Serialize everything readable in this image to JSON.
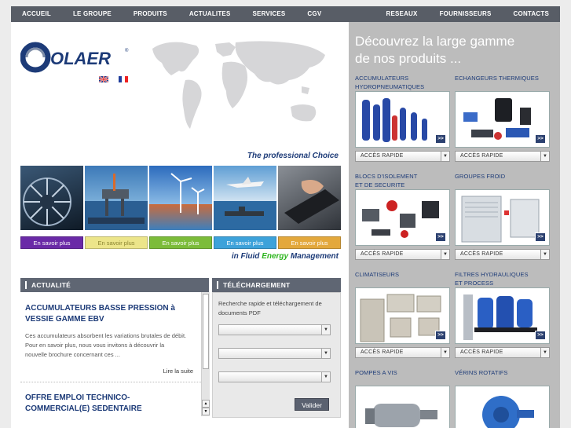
{
  "nav": {
    "left": [
      "ACCUEIL",
      "LE GROUPE",
      "PRODUITS",
      "ACTUALITES",
      "SERVICES",
      "CGV"
    ],
    "right": [
      "RESEAUX",
      "FOURNISSEURS",
      "CONTACTS"
    ]
  },
  "brand": {
    "logo_text": "OLAER",
    "registered": "®"
  },
  "taglines": {
    "top": "The professional Choice",
    "bottom_pre": "in Fluid ",
    "bottom_word": "Energy",
    "bottom_post": " Management"
  },
  "savoir_buttons": [
    {
      "label": "En savoir plus",
      "color": "#6a2aa7"
    },
    {
      "label": "En savoir plus",
      "color": "#ece58a"
    },
    {
      "label": "En savoir plus",
      "color": "#7cbc3a"
    },
    {
      "label": "En savoir plus",
      "color": "#3da2da"
    },
    {
      "label": "En savoir plus",
      "color": "#e3a83c"
    }
  ],
  "news": {
    "header": "ACTUALITÉ",
    "items": [
      {
        "title_l1": "ACCUMULATEURS BASSE PRESSION à",
        "title_l2": "VESSIE GAMME EBV",
        "body_l1": "Ces accumulateurs absorbent les variations brutales de débit.",
        "body_l2": "Pour en savoir plus, nous vous invitons à découvrir la",
        "body_l3": "nouvelle brochure concernant ces ...",
        "more": "Lire la suite"
      },
      {
        "title_l1": "OFFRE EMPLOI TECHNICO-",
        "title_l2": "COMMERCIAL(E) SEDENTAIRE"
      }
    ]
  },
  "download": {
    "header": "TÉLÉCHARGEMENT",
    "intro_l1": "Recherche rapide et téléchargement de",
    "intro_l2": "documents PDF",
    "selects": [
      "",
      "",
      ""
    ],
    "submit": "Valider"
  },
  "products": {
    "title_l1": "Découvrez la large gamme",
    "title_l2": "de nos produits ...",
    "go_label": ">>",
    "drop_label": "ACCÈS RAPIDE",
    "categories": [
      {
        "l1": "ACCUMULATEURS",
        "l2": "HYDROPNEUMATIQUES"
      },
      {
        "l1": "ECHANGEURS THERMIQUES",
        "l2": ""
      },
      {
        "l1": "BLOCS D'ISOLEMENT",
        "l2": "ET DE SECURITE"
      },
      {
        "l1": "GROUPES FROID",
        "l2": ""
      },
      {
        "l1": "CLIMATISEURS",
        "l2": ""
      },
      {
        "l1": "FILTRES HYDRAULIQUES",
        "l2": "ET PROCESS"
      },
      {
        "l1": "POMPES A VIS",
        "l2": ""
      },
      {
        "l1": "VÉRINS ROTATIFS",
        "l2": ""
      }
    ]
  },
  "colors": {
    "nav": "#585d66",
    "brand_blue": "#1d3b78",
    "energy_green": "#2db51e"
  }
}
